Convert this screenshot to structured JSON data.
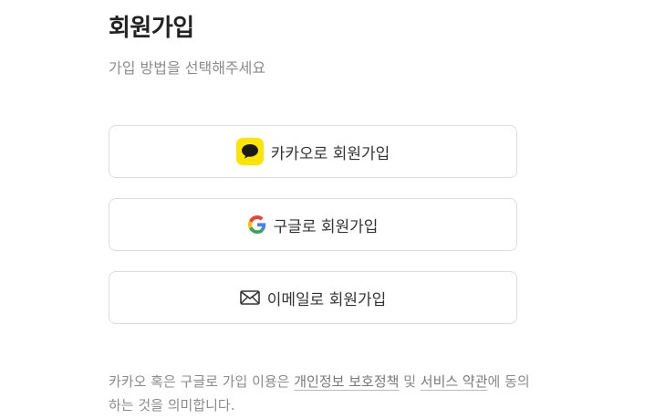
{
  "header": {
    "title": "회원가입",
    "subtitle": "가입 방법을 선택해주세요"
  },
  "buttons": {
    "kakao_label": "카카오로 회원가입",
    "google_label": "구글로 회원가입",
    "email_label": "이메일로 회원가입"
  },
  "icons": {
    "kakao": "kakao-speech-bubble-icon",
    "google": "google-g-icon",
    "email": "envelope-icon"
  },
  "notice": {
    "prefix": "카카오 혹은 구글로 가입 이용은 ",
    "privacy_link": "개인정보 보호정책",
    "middle": " 및 ",
    "terms_link": "서비스 약관",
    "suffix": "에 동의하는 것을 의미합니다."
  },
  "colors": {
    "kakao_yellow": "#fee500",
    "text_muted": "#8b8b8b",
    "border": "#dcdcdc"
  }
}
